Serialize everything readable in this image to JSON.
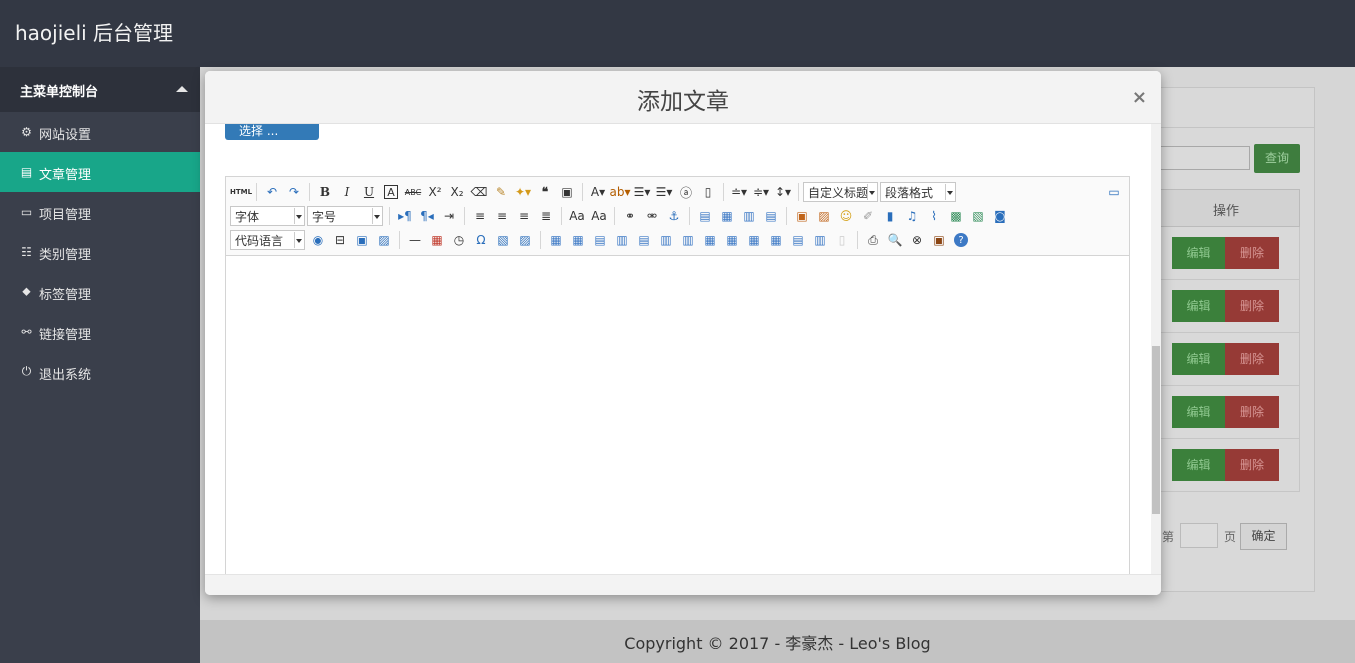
{
  "app": {
    "brand": "haojieli 后台管理"
  },
  "sidebar": {
    "header": "主菜单控制台",
    "items": [
      {
        "label": "网站设置",
        "icon": "gear-icon",
        "glyph": "⚙"
      },
      {
        "label": "文章管理",
        "icon": "file-icon",
        "glyph": "▤",
        "active": true
      },
      {
        "label": "项目管理",
        "icon": "window-icon",
        "glyph": "▭"
      },
      {
        "label": "类别管理",
        "icon": "list-icon",
        "glyph": "☷"
      },
      {
        "label": "标签管理",
        "icon": "tag-icon",
        "glyph": "⬥"
      },
      {
        "label": "链接管理",
        "icon": "link-icon",
        "glyph": "⚯"
      },
      {
        "label": "退出系统",
        "icon": "power-icon",
        "glyph": "⏻"
      }
    ]
  },
  "background": {
    "query_label": "查询",
    "op_header": "操作",
    "edit_label": "编辑",
    "delete_label": "删除",
    "pager": {
      "prefix": "第",
      "suffix": "页",
      "confirm": "确定"
    }
  },
  "footer": {
    "text": "Copyright © 2017 - 李豪杰 - Leo's Blog"
  },
  "modal": {
    "title": "添加文章",
    "close": "×",
    "choose_button": "选择 ...",
    "toolbar": {
      "custom_title": "自定义标题",
      "paragraph": "段落格式",
      "font_family": "字体",
      "font_size": "字号",
      "code_lang": "代码语言"
    }
  },
  "colors": {
    "accent": "#18a689",
    "sidebar": "#3a3f4b",
    "topbar": "#333844",
    "primary": "#337ab7"
  }
}
